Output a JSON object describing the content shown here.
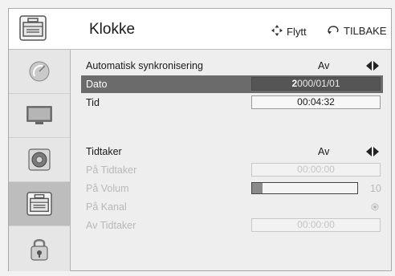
{
  "header": {
    "title": "Klokke",
    "move_hint": "Flytt",
    "back_hint": "TILBAKE"
  },
  "sidebar": {
    "items": [
      {
        "icon": "satellite-dish-icon",
        "active": false
      },
      {
        "icon": "tv-monitor-icon",
        "active": false
      },
      {
        "icon": "speaker-icon",
        "active": false
      },
      {
        "icon": "toolbox-icon",
        "active": true
      },
      {
        "icon": "lock-icon",
        "active": false
      }
    ]
  },
  "settings": {
    "auto_sync": {
      "label": "Automatisk synkronisering",
      "value": "Av"
    },
    "date": {
      "label": "Dato",
      "value_cursor": "2",
      "value_rest": "000/01/01"
    },
    "time": {
      "label": "Tid",
      "value": "00:04:32"
    },
    "timer": {
      "label": "Tidtaker",
      "value": "Av"
    },
    "on_timer": {
      "label": "På Tidtaker",
      "value": "00:00:00"
    },
    "on_volume": {
      "label": "På Volum",
      "value": "10",
      "level": 10
    },
    "on_channel": {
      "label": "På Kanal"
    },
    "off_timer": {
      "label": "Av Tidtaker",
      "value": "00:00:00"
    }
  },
  "colors": {
    "selected_row": "#6b6b6b",
    "disabled_text": "#b8b8b8"
  }
}
